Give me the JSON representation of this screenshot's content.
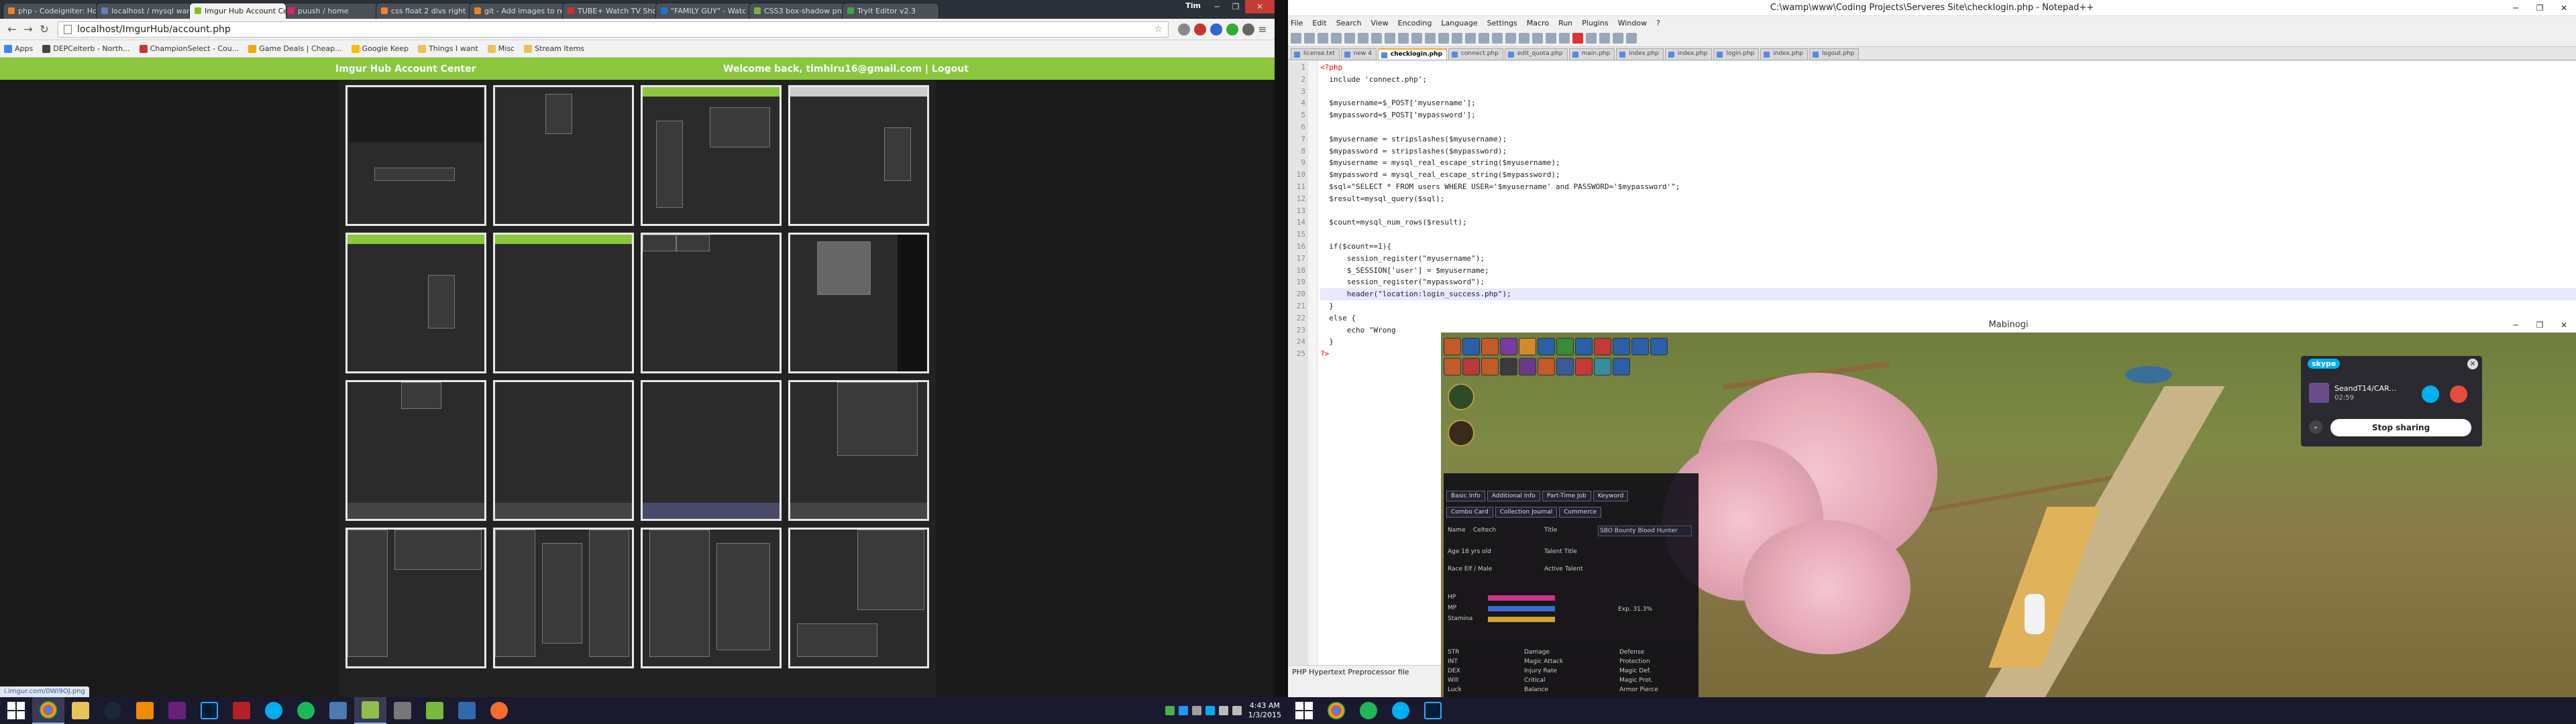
{
  "chrome": {
    "tabs": [
      {
        "label": "php - Codeigniter: Ho",
        "fav": "#f48024"
      },
      {
        "label": "localhost / mysql wam",
        "fav": "#6c7eb7"
      },
      {
        "label": "Imgur Hub Account Ce",
        "fav": "#85bf25"
      },
      {
        "label": "puush / home",
        "fav": "#e91e63"
      },
      {
        "label": "css float 2 divs right",
        "fav": "#f48024"
      },
      {
        "label": "git - Add images to re",
        "fav": "#f48024"
      },
      {
        "label": "TUBE+ Watch TV Sho",
        "fav": "#d32f2f"
      },
      {
        "label": "\"FAMILY GUY\" - Watc",
        "fav": "#1976d2"
      },
      {
        "label": "CSS3 box-shadow pro",
        "fav": "#7cb342"
      },
      {
        "label": "Tryit Editor v2.3",
        "fav": "#43a047"
      }
    ],
    "user": "Tim",
    "url": "localhost/ImgurHub/account.php",
    "bookmarks": [
      "Apps",
      "DEPCelterb - North...",
      "ChampionSelect - Cou...",
      "Game Deals | Cheap...",
      "Google Keep",
      "Things I want",
      "Misc",
      "Stream Items"
    ],
    "site_title": "Imgur Hub Account Center",
    "welcome": "Welcome back, timhiru16@gmail.com | Logout",
    "status_url": "i.imgur.com/0WI9OJ.png"
  },
  "taskbar_left": {
    "time": "4:43 AM",
    "date": "1/3/2015",
    "apps": [
      "windows",
      "chrome",
      "explorer",
      "steam",
      "vlc",
      "visual-studio",
      "photoshop",
      "filezilla",
      "skype",
      "spotify",
      "network",
      "notepad-plus",
      "vmware",
      "utorrent",
      "teamspeak",
      "origin"
    ]
  },
  "taskbar_right": {
    "apps": [
      "windows",
      "chrome",
      "spotify",
      "skype",
      "photoshop"
    ]
  },
  "npp": {
    "title": "C:\\wamp\\www\\Coding Projects\\Serveres Site\\checklogin.php - Notepad++",
    "menu": [
      "File",
      "Edit",
      "Search",
      "View",
      "Encoding",
      "Language",
      "Settings",
      "Macro",
      "Run",
      "Plugins",
      "Window",
      "?"
    ],
    "tabs": [
      "license.txt",
      "new 4",
      "checklogin.php",
      "connect.php",
      "edit_quota.php",
      "main.php",
      "index.php",
      "index.php",
      "login.php",
      "index.php",
      "logout.php"
    ],
    "active_tab": "checklogin.php",
    "status": "PHP Hypertext Preprocessor file",
    "lines": [
      "<?php",
      "  include 'connect.php';",
      "",
      "  $myusername=$_POST['myusername'];",
      "  $mypassword=$_POST['mypassword'];",
      "",
      "  $myusername = stripslashes($myusername);",
      "  $mypassword = stripslashes($mypassword);",
      "  $myusername = mysql_real_escape_string($myusername);",
      "  $mypassword = mysql_real_escape_string($mypassword);",
      "  $sql=\"SELECT * FROM users WHERE USER='$myusername' and PASSWORD='$mypassword'\";",
      "  $result=mysql_query($sql);",
      "",
      "  $count=mysql_num_rows($result);",
      "",
      "  if($count==1){",
      "      session_register(\"myusername\");",
      "      $_SESSION['user'] = $myusername;",
      "      session_register(\"mypassword\");",
      "      header(\"location:login_success.php\");",
      "  }",
      "  else {",
      "      echo \"Wrong",
      "  }",
      "?>"
    ]
  },
  "mabi": {
    "title": "Mabinogi",
    "char_tabs": [
      "Basic Info",
      "Additional Info",
      "Part-Time Job",
      "Keyword"
    ],
    "char_tabs2": [
      "Combo Card",
      "Collection Journal",
      "Commerce"
    ],
    "name_label": "Name",
    "name": "Celtech",
    "title_label": "Title",
    "title_value": "SBO Bounty Blood Hunter",
    "age": "Age  18 yrs old",
    "race": "Race  Elf / Male",
    "talent_title": "Talent Title",
    "active_talent": "Active Talent",
    "stats": [
      "HP",
      "MP",
      "Stamina"
    ],
    "stats2": [
      "STR",
      "INT",
      "DEX",
      "Will",
      "Luck"
    ],
    "combat": [
      "Damage",
      "Magic Attack",
      "Injury Rate",
      "Critical",
      "Balance"
    ],
    "defense": [
      "Defense",
      "Protection",
      "Magic Def.",
      "Magic Prot.",
      "Armor Pierce"
    ],
    "xp": "Exp. 31.3%"
  },
  "skype": {
    "logo": "skype",
    "caller": "SeandT14/CAR...",
    "duration": "02:59",
    "stop": "Stop sharing"
  }
}
